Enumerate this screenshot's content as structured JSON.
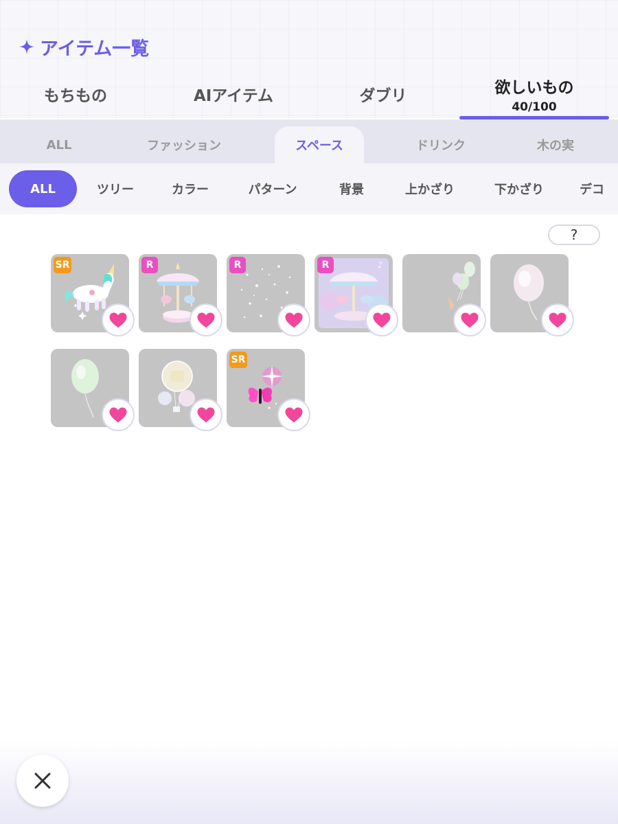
{
  "header": {
    "title": "アイテム一覧"
  },
  "main_tabs": [
    {
      "label": "もちもの"
    },
    {
      "label": "AIアイテム"
    },
    {
      "label": "ダブリ"
    },
    {
      "label": "欲しいもの",
      "sub": "40/100",
      "active": true
    }
  ],
  "category_tabs": [
    {
      "label": "ALL"
    },
    {
      "label": "ファッション"
    },
    {
      "label": "スペース",
      "active": true
    },
    {
      "label": "ドリンク"
    },
    {
      "label": "木の実"
    }
  ],
  "filter_chips": [
    {
      "label": "ALL",
      "active": true
    },
    {
      "label": "ツリー"
    },
    {
      "label": "カラー"
    },
    {
      "label": "パターン"
    },
    {
      "label": "背景"
    },
    {
      "label": "上かざり"
    },
    {
      "label": "下かざり"
    },
    {
      "label": "デコ"
    }
  ],
  "help": {
    "label": "?"
  },
  "items": [
    {
      "rarity": "SR",
      "art": "unicorn"
    },
    {
      "rarity": "R",
      "art": "carousel"
    },
    {
      "rarity": "R",
      "art": "sparkles"
    },
    {
      "rarity": "R",
      "art": "carousel-bg"
    },
    {
      "rarity": "",
      "art": "balloon-bunch"
    },
    {
      "rarity": "",
      "art": "pastel-balloon"
    },
    {
      "rarity": "",
      "art": "green-balloon"
    },
    {
      "rarity": "",
      "art": "bubble-balloons"
    },
    {
      "rarity": "SR",
      "art": "pink-butterfly"
    }
  ],
  "colors": {
    "accent": "#6b5ee8",
    "heart": "#f0479c",
    "sr_badge": "#f29a1a",
    "r_badge": "#ea4fc1",
    "tile": "#c4c4c4"
  },
  "icons": {
    "title": "sparkle-icon",
    "favorite": "heart-icon",
    "close": "close-icon"
  }
}
